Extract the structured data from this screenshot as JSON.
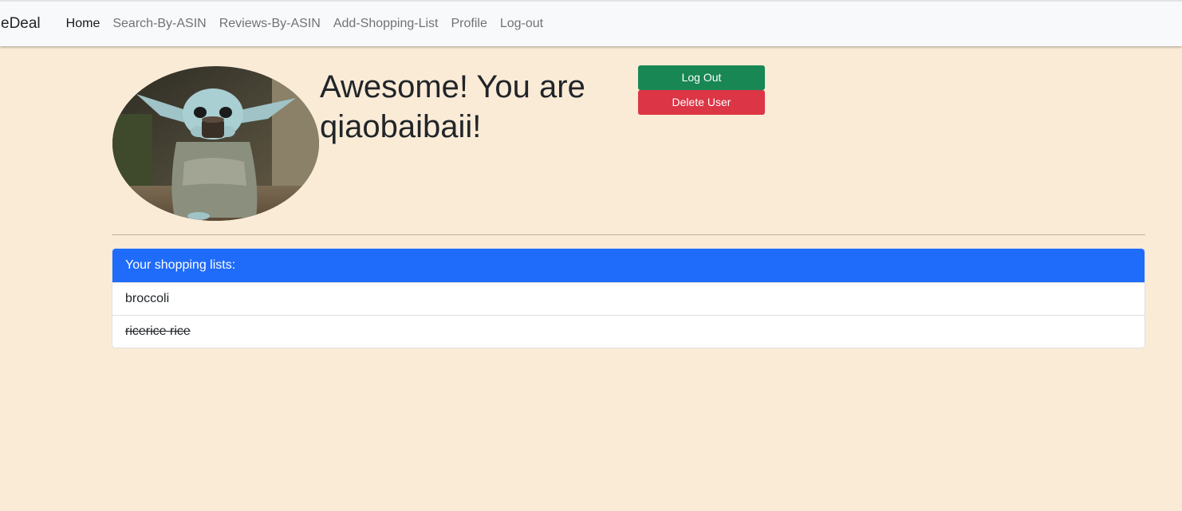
{
  "navbar": {
    "brand": "eDeal",
    "links": [
      {
        "label": "Home",
        "active": true
      },
      {
        "label": "Search-By-ASIN",
        "active": false
      },
      {
        "label": "Reviews-By-ASIN",
        "active": false
      },
      {
        "label": "Add-Shopping-List",
        "active": false
      },
      {
        "label": "Profile",
        "active": false
      },
      {
        "label": "Log-out",
        "active": false
      }
    ]
  },
  "profile": {
    "greeting": "Awesome! You are qiaobaibaii!",
    "avatar_icon": "baby-yoda-avatar"
  },
  "actions": {
    "logout_label": "Log Out",
    "delete_label": "Delete User",
    "logout_color": "#198754",
    "delete_color": "#dc3545"
  },
  "shopping": {
    "header": "Your shopping lists:",
    "header_color": "#1f6bfa",
    "items": [
      {
        "name": "broccoli",
        "done": false
      },
      {
        "name": "ricerice rice",
        "done": true
      }
    ]
  }
}
